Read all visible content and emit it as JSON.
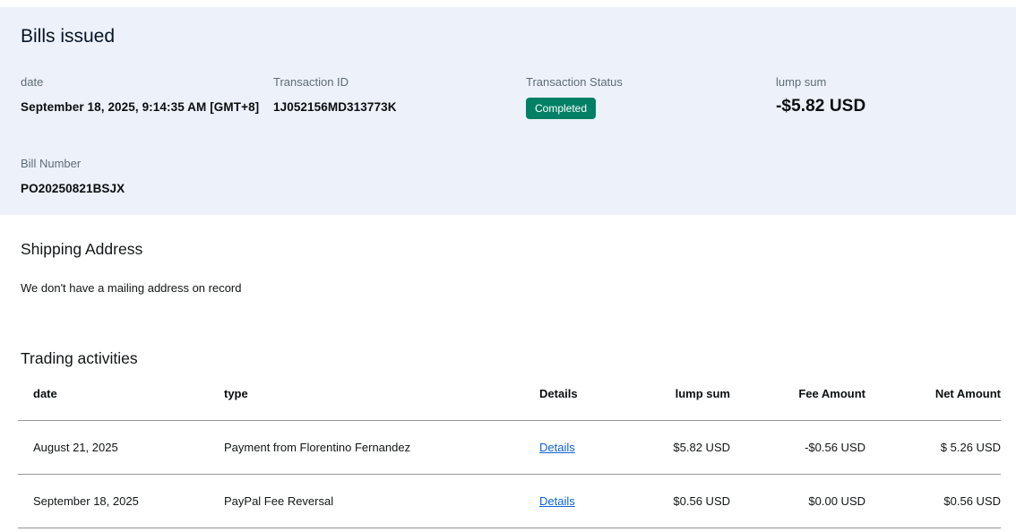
{
  "header": {
    "title": "Bills issued",
    "date": {
      "label": "date",
      "value": "September 18, 2025, 9:14:35 AM [GMT+8]"
    },
    "transaction_id": {
      "label": "Transaction ID",
      "value": "1J052156MD313773K"
    },
    "transaction_status": {
      "label": "Transaction Status",
      "badge": "Completed"
    },
    "lump_sum": {
      "label": "lump sum",
      "value": "-$5.82 USD"
    },
    "bill_number": {
      "label": "Bill Number",
      "value": "PO20250821BSJX"
    }
  },
  "shipping": {
    "title": "Shipping Address",
    "message": "We don't have a mailing address on record"
  },
  "activities": {
    "title": "Trading activities",
    "columns": [
      "date",
      "type",
      "Details",
      "lump sum",
      "Fee Amount",
      "Net Amount"
    ],
    "rows": [
      {
        "date": "August 21, 2025",
        "type": "Payment from Florentino Fernandez",
        "details_label": "Details",
        "lump_sum": "$5.82 USD",
        "fee_amount": "-$0.56 USD",
        "net_amount": "$ 5.26 USD"
      },
      {
        "date": "September 18, 2025",
        "type": "PayPal Fee Reversal",
        "details_label": "Details",
        "lump_sum": "$0.56 USD",
        "fee_amount": "$0.00 USD",
        "net_amount": "$0.56 USD"
      }
    ]
  },
  "colors": {
    "panel_background": "#edf1f9",
    "status_green": "#018065",
    "link_blue": "#0c62d6",
    "divider_gray": "#949699"
  }
}
